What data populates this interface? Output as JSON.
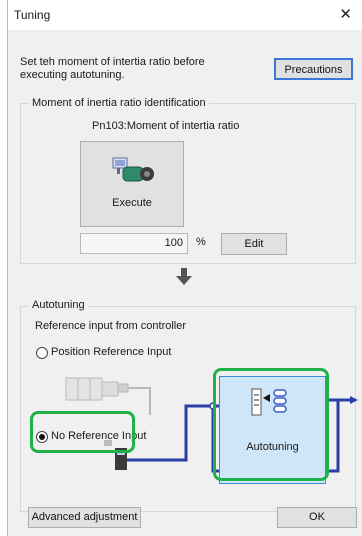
{
  "window": {
    "title": "Tuning",
    "close_glyph": "✕"
  },
  "intro": {
    "text": "Set teh moment of intertia ratio before executing autotuning.",
    "precautions_label": "Precautions"
  },
  "moment_group": {
    "legend": "Moment of inertia ratio identification",
    "param_label": "Pn103:Moment of intertia ratio",
    "execute_label": "Execute",
    "execute_icon": "motor-execute-icon",
    "ratio_value": "100",
    "unit": "%",
    "edit_label": "Edit"
  },
  "flow_arrow_icon": "down-arrow-icon",
  "autotuning_group": {
    "legend": "Autotuning",
    "subtitle": "Reference input from controller",
    "options": [
      {
        "label": "Position Reference Input",
        "selected": false
      },
      {
        "label": "No Reference Input",
        "selected": true
      }
    ],
    "autotuning_label": "Autotuning",
    "autotuning_icon": "autotuning-icon",
    "highlight_color": "#21b14b",
    "wire_color": "#2b3ea8"
  },
  "footer": {
    "advanced_label": "Advanced adjustment",
    "ok_label": "OK"
  }
}
